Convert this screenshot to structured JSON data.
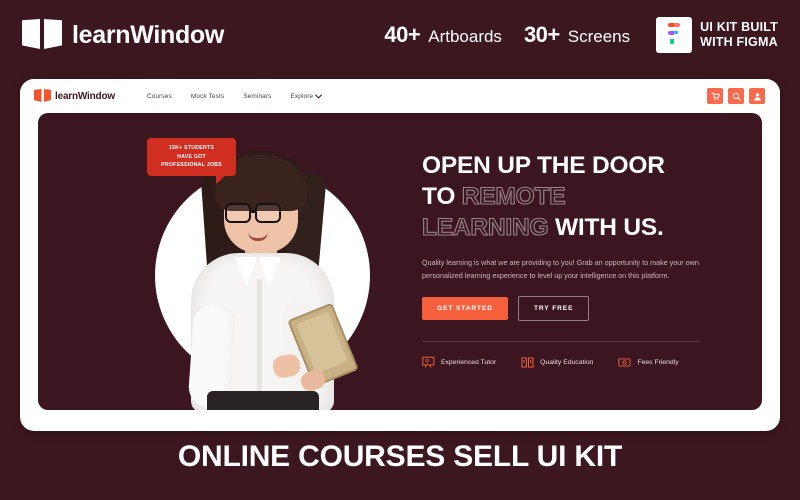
{
  "page": {
    "background_color": "#3d1720",
    "accent_color": "#f4603c",
    "bottom_title": "ONLINE COURSES SELL UI KIT"
  },
  "topbar": {
    "brand_name": "learnWindow",
    "brand_icon": "open-book-icon",
    "stats": [
      {
        "number": "40+",
        "label": "Artboards"
      },
      {
        "number": "30+",
        "label": "Screens"
      }
    ],
    "figma_badge": {
      "icon": "figma-logo-icon",
      "text": "UI KIT BUILT\nWITH FIGMA"
    }
  },
  "mockup": {
    "site_nav": {
      "brand_name": "learnWindow",
      "brand_icon": "open-book-icon",
      "links": [
        {
          "label": "Courses",
          "has_chevron": false
        },
        {
          "label": "Mock Tests",
          "has_chevron": false
        },
        {
          "label": "Seminars",
          "has_chevron": false
        },
        {
          "label": "Explore",
          "has_chevron": true
        }
      ],
      "actions": [
        {
          "icon": "shopping-cart-icon"
        },
        {
          "icon": "search-icon"
        },
        {
          "icon": "user-account-icon"
        }
      ]
    },
    "hero": {
      "badge_text": "15K+ STUDENTS\nHAVE GOT\nPROFESSIONAL JOBS",
      "photo_alt": "smiling-woman-with-glasses-holding-tablet",
      "heading": {
        "line1_solid": "OPEN UP THE DOOR",
        "line2_solid": "TO ",
        "line2_outline": "REMOTE",
        "line3_outline": "LEARNING",
        "line3_solid": " WITH US."
      },
      "paragraph": "Quality learning is what we are providing to you! Grab an opportunity to make your own personalized learning experience to level up your intelligence on this platform.",
      "primary_cta": "GET STARTED",
      "secondary_cta": "TRY FREE",
      "features": [
        {
          "label": "Experienced Tutor",
          "icon": "tutor-board-icon"
        },
        {
          "label": "Quality Education",
          "icon": "open-book-icon"
        },
        {
          "label": "Fees Friendly",
          "icon": "money-note-icon"
        }
      ]
    }
  }
}
